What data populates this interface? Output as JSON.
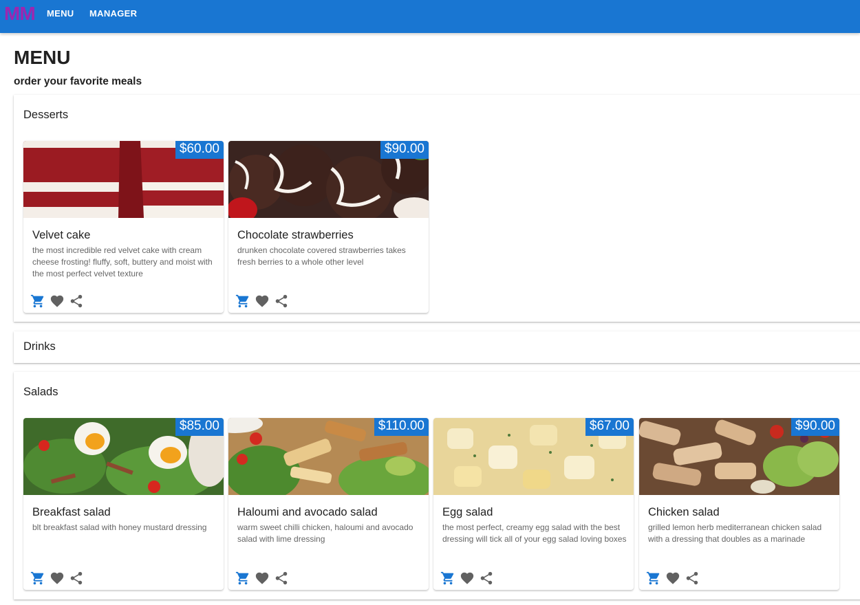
{
  "header": {
    "logo": "MM",
    "nav": [
      "MENU",
      "MANAGER"
    ]
  },
  "page": {
    "title": "MENU",
    "subtitle": "order your favorite meals"
  },
  "colors": {
    "primary": "#1976d2",
    "logo": "#9c27b0",
    "icon_grey": "#616161"
  },
  "sections": {
    "desserts": {
      "title": "Desserts",
      "items": [
        {
          "name": "Velvet cake",
          "price": "$60.00",
          "description": "the most incredible red velvet cake with cream cheese frosting! fluffy, soft, buttery and moist with the most perfect velvet texture"
        },
        {
          "name": "Chocolate strawberries",
          "price": "$90.00",
          "description": "drunken chocolate covered strawberries takes fresh berries to a whole other level"
        }
      ]
    },
    "drinks": {
      "title": "Drinks"
    },
    "salads": {
      "title": "Salads",
      "items": [
        {
          "name": "Breakfast salad",
          "price": "$85.00",
          "description": "blt breakfast salad with honey mustard dressing"
        },
        {
          "name": "Haloumi and avocado salad",
          "price": "$110.00",
          "description": "warm sweet chilli chicken, haloumi and avocado salad with lime dressing"
        },
        {
          "name": "Egg salad",
          "price": "$67.00",
          "description": "the most perfect, creamy egg salad with the best dressing will tick all of your egg salad loving boxes"
        },
        {
          "name": "Chicken salad",
          "price": "$90.00",
          "description": "grilled lemon herb mediterranean chicken salad with a dressing that doubles as a marinade"
        }
      ]
    }
  },
  "card_actions": [
    "cart-icon",
    "heart-icon",
    "share-icon"
  ]
}
